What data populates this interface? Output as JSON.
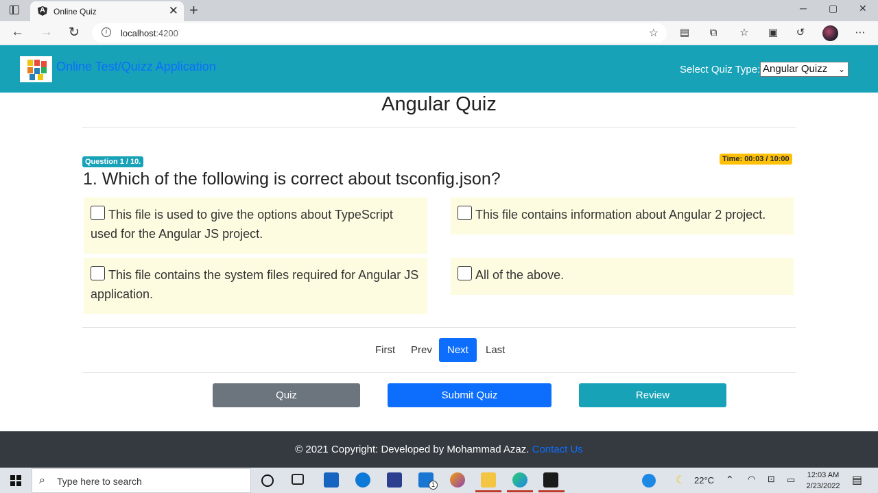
{
  "browser": {
    "tab_title": "Online Quiz",
    "tab_close": "✕",
    "new_tab": "+",
    "url_host": "localhost",
    "url_port": ":4200",
    "window_controls": {
      "minimize": "─",
      "maximize": "▢",
      "close": "✕"
    }
  },
  "header": {
    "app_title": "Online Test/Quizz Application",
    "quiz_type_label": "Select Quiz Type:",
    "quiz_type_selected": "Angular Quizz"
  },
  "quiz": {
    "title": "Angular Quiz",
    "question_badge": "Question 1 / 10.",
    "time_badge": "Time: 00:03 / 10:00",
    "question": "1. Which of the following is correct about tsconfig.json?",
    "options": [
      "This file is used to give the options about TypeScript used for the Angular JS project.",
      "This file contains information about Angular 2 project.",
      "This file contains the system files required for Angular JS application.",
      "All of the above."
    ]
  },
  "pager": {
    "first": "First",
    "prev": "Prev",
    "next": "Next",
    "last": "Last"
  },
  "actions": {
    "quiz": "Quiz",
    "submit": "Submit Quiz",
    "review": "Review"
  },
  "footer": {
    "copyright": "© 2021 Copyright: Developed by Mohammad Azaz.",
    "contact_link": "Contact Us"
  },
  "taskbar": {
    "search_placeholder": "Type here to search",
    "temperature": "22°C",
    "time": "12:03 AM",
    "date": "2/23/2022",
    "mail_badge": "1"
  },
  "colors": {
    "header_bg": "#17a2b8",
    "primary": "#0d6efd",
    "secondary": "#6c757d",
    "warning": "#ffc107",
    "option_bg": "#fdfbe0",
    "footer_bg": "#343a40"
  }
}
